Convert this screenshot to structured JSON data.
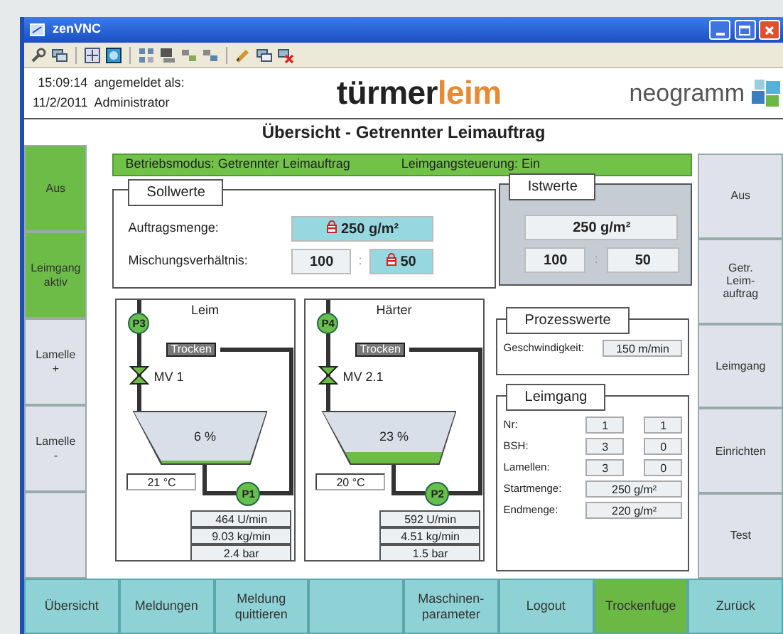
{
  "window": {
    "title": "zenVNC"
  },
  "header": {
    "time": "15:09:14",
    "date": "11/2/2011",
    "login_label": "angemeldet als:",
    "user": "Administrator",
    "logo_main": "türmer",
    "logo_accent": "leim",
    "brand": "neogramm"
  },
  "page_title": "Übersicht - Getrennter Leimauftrag",
  "left_buttons": [
    {
      "lines": [
        "Aus"
      ],
      "active": true
    },
    {
      "lines": [
        "Leimgang",
        "aktiv"
      ],
      "active": true
    },
    {
      "lines": [
        "Lamelle",
        "+"
      ],
      "active": false
    },
    {
      "lines": [
        "Lamelle",
        "-"
      ],
      "active": false
    },
    {
      "active": false
    }
  ],
  "status_bar": {
    "mode": "Betriebsmodus: Getrennter Leimauftrag",
    "control": "Leimgangsteuerung: Ein"
  },
  "sollwerte": {
    "title": "Sollwerte",
    "amount_label": "Auftragsmenge:",
    "amount": {
      "value": "250 g/m²",
      "locked": true
    },
    "ratio_label": "Mischungsverhältnis:",
    "ratio_a": {
      "value": "100",
      "locked": false
    },
    "separator": ":",
    "ratio_b": {
      "value": "50",
      "locked": true
    }
  },
  "istwerte": {
    "title": "Istwerte",
    "amount": "250 g/m²",
    "ratio_a": "100",
    "separator": ":",
    "ratio_b": "50"
  },
  "tanks": [
    {
      "title": "Leim",
      "feed_pump": "P3",
      "dry_label": "Trocken",
      "valve": "MV 1",
      "percent": "6 %",
      "temperature": "21 °C",
      "pump": "P1",
      "readings": [
        "464 U/min",
        "9.03 kg/min",
        "2.4 bar"
      ]
    },
    {
      "title": "Härter",
      "feed_pump": "P4",
      "dry_label": "Trocken",
      "valve": "MV 2.1",
      "percent": "23 %",
      "temperature": "20 °C",
      "pump": "P2",
      "readings": [
        "592 U/min",
        "4.51 kg/min",
        "1.5 bar"
      ]
    }
  ],
  "prozesswerte": {
    "title": "Prozesswerte",
    "rows": [
      {
        "label": "Geschwindigkeit:",
        "values": [
          "150 m/min"
        ]
      }
    ]
  },
  "leimgang": {
    "title": "Leimgang",
    "rows": [
      {
        "label": "Nr:",
        "values": [
          "1",
          "1"
        ]
      },
      {
        "label": "BSH:",
        "values": [
          "3",
          "0"
        ]
      },
      {
        "label": "Lamellen:",
        "values": [
          "3",
          "0"
        ]
      },
      {
        "label": "Startmenge:",
        "values": [
          "250 g/m²"
        ]
      },
      {
        "label": "Endmenge:",
        "values": [
          "220 g/m²"
        ]
      }
    ]
  },
  "right_buttons": [
    {
      "lines": [
        "Aus"
      ]
    },
    {
      "lines": [
        "Getr.",
        "Leim-",
        "auftrag"
      ]
    },
    {
      "lines": [
        "Leimgang"
      ]
    },
    {
      "lines": [
        "Einrichten"
      ]
    },
    {
      "lines": [
        "Test"
      ]
    }
  ],
  "bottom_nav": [
    {
      "lines": [
        "Übersicht"
      ],
      "active": false
    },
    {
      "lines": [
        "Meldungen"
      ],
      "active": false
    },
    {
      "lines": [
        "Meldung",
        "quittieren"
      ],
      "active": false
    },
    {
      "active": false
    },
    {
      "lines": [
        "Maschinen-",
        "parameter"
      ],
      "active": false
    },
    {
      "lines": [
        "Logout"
      ],
      "active": false
    },
    {
      "lines": [
        "Trockenfuge"
      ],
      "active": true
    },
    {
      "lines": [
        "Zurück"
      ],
      "active": false
    }
  ]
}
